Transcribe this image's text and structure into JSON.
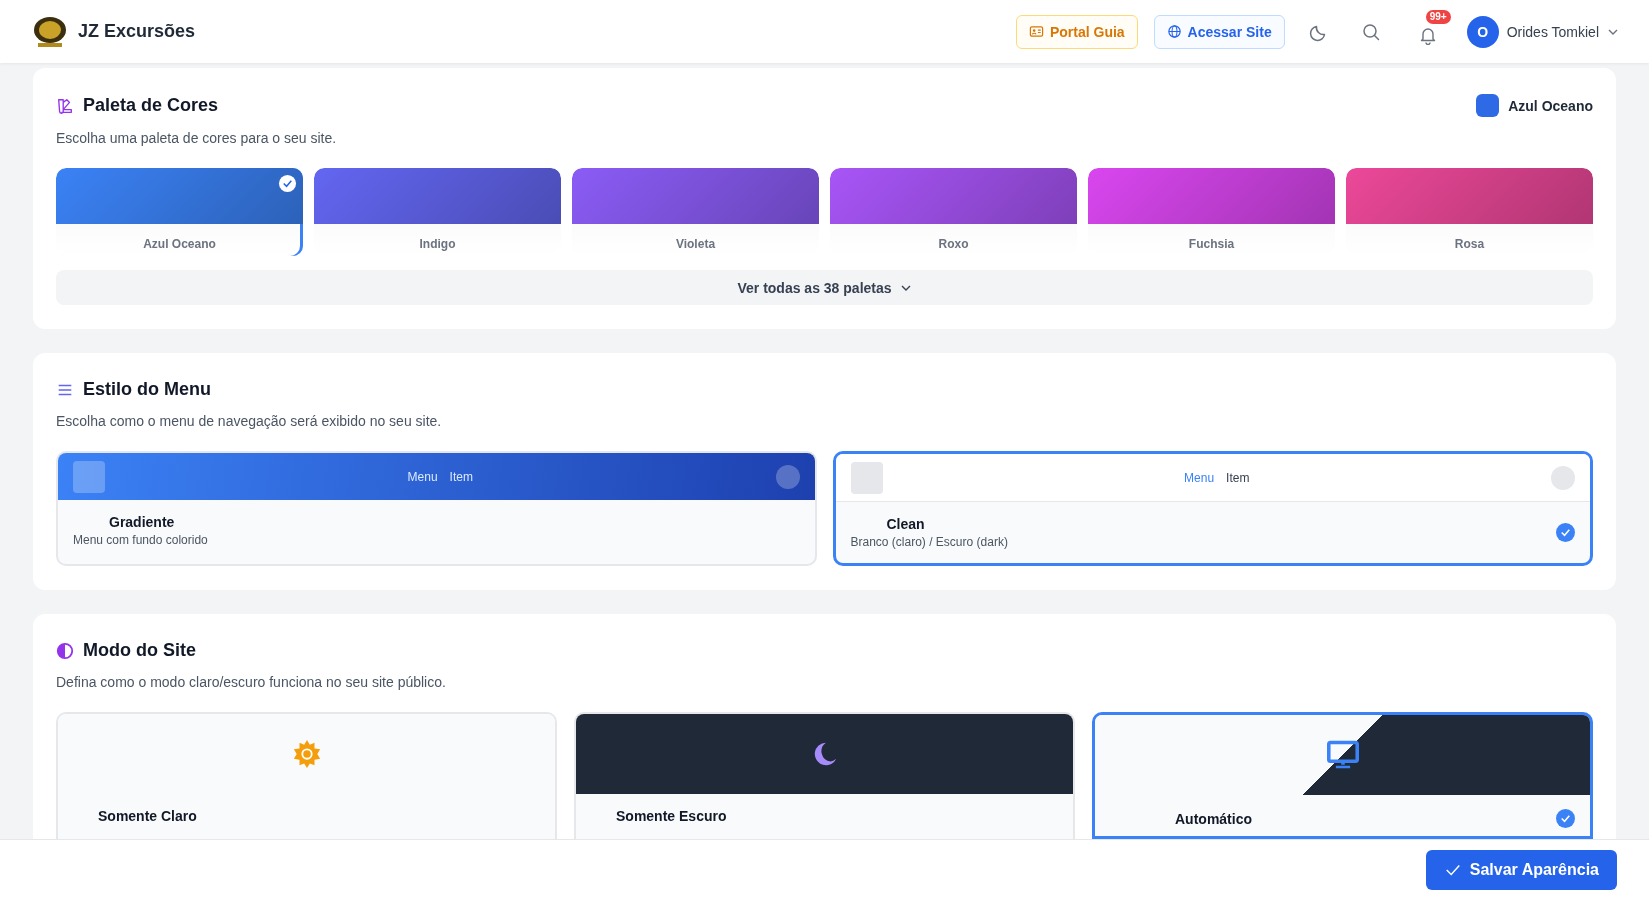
{
  "header": {
    "brand": "JZ Excursões",
    "portal_button": "Portal Guia",
    "site_button": "Acessar Site",
    "notification_badge": "99+",
    "user": {
      "initial": "O",
      "name": "Orides Tomkiel"
    }
  },
  "palette_section": {
    "title": "Paleta de Cores",
    "description": "Escolha uma paleta de cores para o seu site.",
    "current": {
      "name": "Azul Oceano",
      "color": "#2f6ae6"
    },
    "palettes": [
      {
        "name": "Azul Oceano",
        "color": "#3b82f6",
        "selected": true
      },
      {
        "name": "Indigo",
        "color": "#6366f1",
        "selected": false
      },
      {
        "name": "Violeta",
        "color": "#8b5cf6",
        "selected": false
      },
      {
        "name": "Roxo",
        "color": "#a855f7",
        "selected": false
      },
      {
        "name": "Fuchsia",
        "color": "#d946ef",
        "selected": false
      },
      {
        "name": "Rosa",
        "color": "#ec4899",
        "selected": false
      }
    ],
    "show_all_button": "Ver todas as 38 paletas"
  },
  "menu_section": {
    "title": "Estilo do Menu",
    "description": "Escolha como o menu de navegação será exibido no seu site.",
    "options": [
      {
        "kind": "gradient",
        "preview_links": [
          "Menu",
          "Item"
        ],
        "name": "Gradiente",
        "description": "Menu com fundo colorido",
        "selected": false
      },
      {
        "kind": "clean",
        "preview_links": [
          "Menu",
          "Item"
        ],
        "name": "Clean",
        "description": "Branco (claro) / Escuro (dark)",
        "selected": true
      }
    ]
  },
  "mode_section": {
    "title": "Modo do Site",
    "description": "Defina como o modo claro/escuro funciona no seu site público.",
    "options": [
      {
        "kind": "light",
        "name": "Somente Claro",
        "selected": false
      },
      {
        "kind": "dark",
        "name": "Somente Escuro",
        "selected": false
      },
      {
        "kind": "auto",
        "name": "Automático",
        "selected": true
      }
    ]
  },
  "save_button": "Salvar Aparência"
}
